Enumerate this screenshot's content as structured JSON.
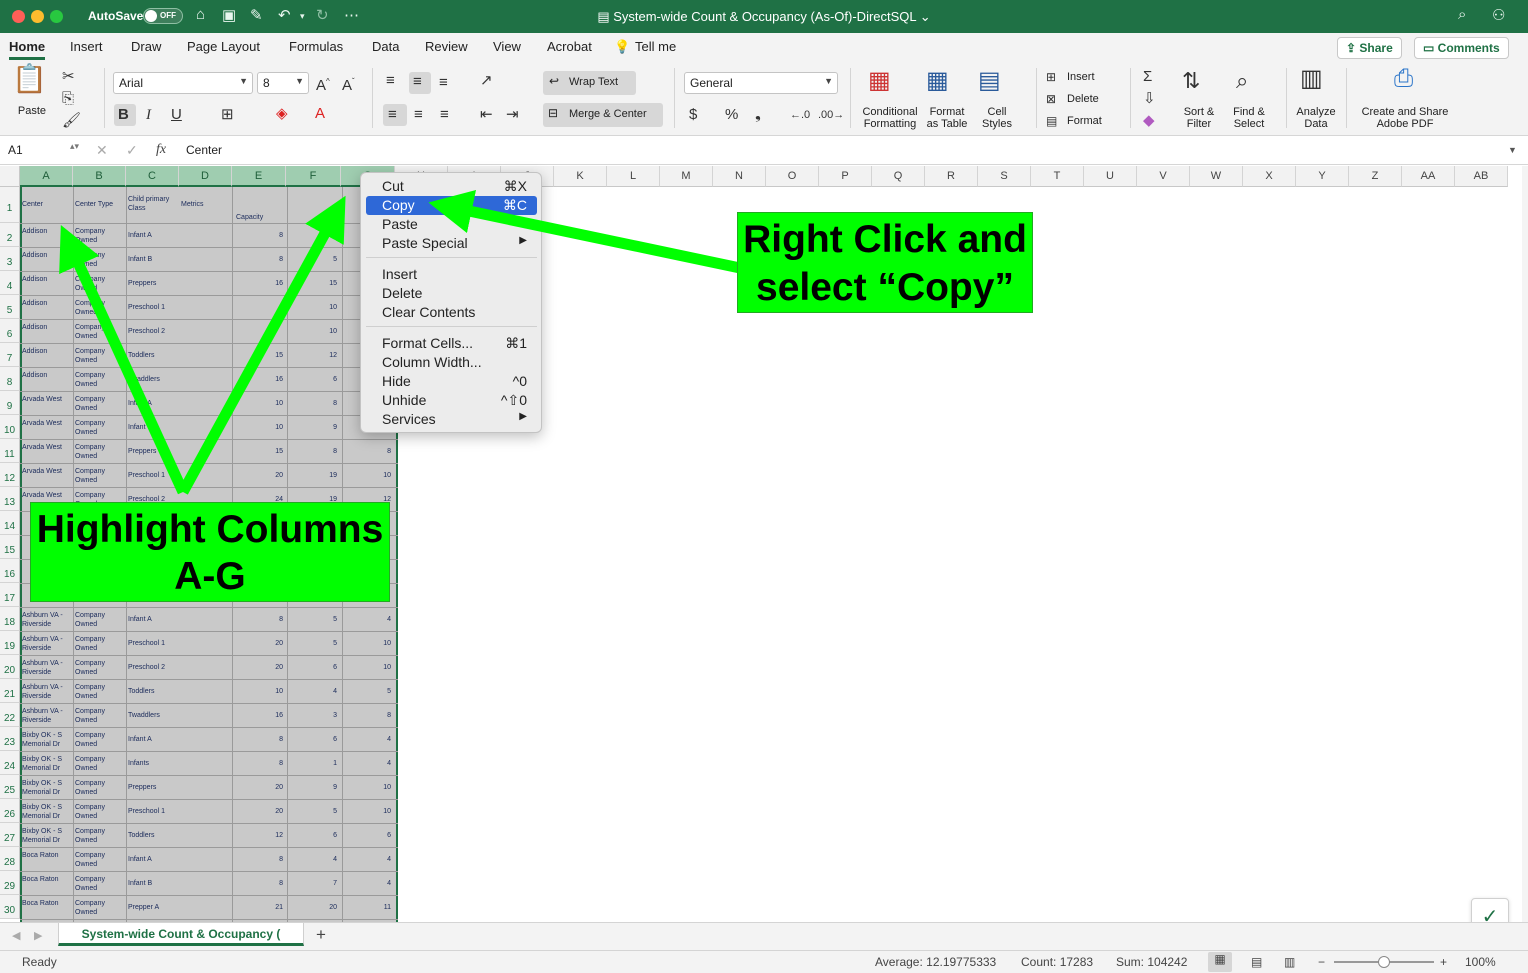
{
  "titlebar": {
    "autosave_label": "AutoSave",
    "autosave_state": "OFF",
    "doc_title": "System-wide Count & Occupancy (As-Of)-DirectSQL",
    "doc_title_caret": "⌄"
  },
  "menu": {
    "tabs": [
      "Home",
      "Insert",
      "Draw",
      "Page Layout",
      "Formulas",
      "Data",
      "Review",
      "View",
      "Acrobat",
      "Tell me"
    ],
    "share_label": "Share",
    "comments_label": "Comments"
  },
  "ribbon": {
    "paste_label": "Paste",
    "font_name": "Arial",
    "font_size": "8",
    "wrap_text_label": "Wrap Text",
    "merge_center_label": "Merge & Center",
    "number_format": "General",
    "conditional_formatting_label": "Conditional Formatting",
    "format_as_table_label": "Format as Table",
    "cell_styles_label": "Cell Styles",
    "insert_label": "Insert",
    "delete_label": "Delete",
    "format_label": "Format",
    "sort_filter_label": "Sort & Filter",
    "find_select_label": "Find & Select",
    "analyze_data_label": "Analyze Data",
    "adobe_pdf_label": "Create and Share Adobe PDF"
  },
  "formula_bar": {
    "cell_ref": "A1",
    "fx_label": "fx",
    "value": "Center"
  },
  "grid": {
    "columns": [
      "A",
      "B",
      "C",
      "D",
      "E",
      "F",
      "G",
      "H",
      "I",
      "J",
      "K",
      "L",
      "M",
      "N",
      "O",
      "P",
      "Q",
      "R",
      "S",
      "T",
      "U",
      "V",
      "W",
      "X",
      "Y",
      "Z",
      "AA",
      "AB"
    ],
    "header_row": {
      "A": "Center",
      "B": "Center Type",
      "C": "Child primary Class",
      "D": "Metrics",
      "E": "Capacity"
    },
    "rows": [
      {
        "n": "2",
        "A": "Addison",
        "B": "Company Owned",
        "C": "Infant A",
        "E": "8",
        "F": "",
        "G": ""
      },
      {
        "n": "3",
        "A": "Addison",
        "B": "Company Owned",
        "C": "Infant B",
        "E": "8",
        "F": "5",
        "G": ""
      },
      {
        "n": "4",
        "A": "Addison",
        "B": "Company Owned",
        "C": "Preppers",
        "E": "16",
        "F": "15",
        "G": ""
      },
      {
        "n": "5",
        "A": "Addison",
        "B": "Company Owned",
        "C": "Preschool 1",
        "E": "",
        "F": "10",
        "G": ""
      },
      {
        "n": "6",
        "A": "Addison",
        "B": "Company Owned",
        "C": "Preschool 2",
        "E": "",
        "F": "10",
        "G": ""
      },
      {
        "n": "7",
        "A": "Addison",
        "B": "Company Owned",
        "C": "Toddlers",
        "E": "15",
        "F": "12",
        "G": ""
      },
      {
        "n": "8",
        "A": "Addison",
        "B": "Company Owned",
        "C": "Twaddlers",
        "E": "16",
        "F": "6",
        "G": ""
      },
      {
        "n": "9",
        "A": "Arvada West",
        "B": "Company Owned",
        "C": "Infant A",
        "E": "10",
        "F": "8",
        "G": ""
      },
      {
        "n": "10",
        "A": "Arvada West",
        "B": "Company Owned",
        "C": "Infant B",
        "E": "10",
        "F": "9",
        "G": ""
      },
      {
        "n": "11",
        "A": "Arvada West",
        "B": "Company Owned",
        "C": "Preppers",
        "E": "15",
        "F": "8",
        "G": "8"
      },
      {
        "n": "12",
        "A": "Arvada West",
        "B": "Company Owned",
        "C": "Preschool 1",
        "E": "20",
        "F": "19",
        "G": "10"
      },
      {
        "n": "13",
        "A": "Arvada West",
        "B": "Company Owned",
        "C": "Preschool 2",
        "E": "24",
        "F": "19",
        "G": "12"
      },
      {
        "n": "14",
        "A": "",
        "B": "",
        "C": "",
        "E": "",
        "F": "",
        "G": ""
      },
      {
        "n": "15",
        "A": "",
        "B": "",
        "C": "",
        "E": "",
        "F": "",
        "G": ""
      },
      {
        "n": "16",
        "A": "",
        "B": "",
        "C": "",
        "E": "",
        "F": "",
        "G": ""
      },
      {
        "n": "17",
        "A": "",
        "B": "",
        "C": "",
        "E": "",
        "F": "",
        "G": ""
      },
      {
        "n": "18",
        "A": "Ashburn VA - Riverside",
        "B": "Company Owned",
        "C": "Infant A",
        "E": "8",
        "F": "5",
        "G": "4"
      },
      {
        "n": "19",
        "A": "Ashburn VA - Riverside",
        "B": "Company Owned",
        "C": "Preschool 1",
        "E": "20",
        "F": "5",
        "G": "10"
      },
      {
        "n": "20",
        "A": "Ashburn VA - Riverside",
        "B": "Company Owned",
        "C": "Preschool 2",
        "E": "20",
        "F": "6",
        "G": "10"
      },
      {
        "n": "21",
        "A": "Ashburn VA - Riverside",
        "B": "Company Owned",
        "C": "Toddlers",
        "E": "10",
        "F": "4",
        "G": "5"
      },
      {
        "n": "22",
        "A": "Ashburn VA - Riverside",
        "B": "Company Owned",
        "C": "Twaddlers",
        "E": "16",
        "F": "3",
        "G": "8"
      },
      {
        "n": "23",
        "A": "Bixby OK - S Memorial Dr",
        "B": "Company Owned",
        "C": "Infant A",
        "E": "8",
        "F": "6",
        "G": "4"
      },
      {
        "n": "24",
        "A": "Bixby OK - S Memorial Dr",
        "B": "Company Owned",
        "C": "Infants",
        "E": "8",
        "F": "1",
        "G": "4"
      },
      {
        "n": "25",
        "A": "Bixby OK - S Memorial Dr",
        "B": "Company Owned",
        "C": "Preppers",
        "E": "20",
        "F": "9",
        "G": "10"
      },
      {
        "n": "26",
        "A": "Bixby OK - S Memorial Dr",
        "B": "Company Owned",
        "C": "Preschool 1",
        "E": "20",
        "F": "5",
        "G": "10"
      },
      {
        "n": "27",
        "A": "Bixby OK - S Memorial Dr",
        "B": "Company Owned",
        "C": "Toddlers",
        "E": "12",
        "F": "6",
        "G": "6"
      },
      {
        "n": "28",
        "A": "Boca Raton",
        "B": "Company Owned",
        "C": "Infant A",
        "E": "8",
        "F": "4",
        "G": "4"
      },
      {
        "n": "29",
        "A": "Boca Raton",
        "B": "Company Owned",
        "C": "Infant B",
        "E": "8",
        "F": "7",
        "G": "4"
      },
      {
        "n": "30",
        "A": "Boca Raton",
        "B": "Company Owned",
        "C": "Prepper A",
        "E": "21",
        "F": "20",
        "G": "11"
      }
    ]
  },
  "context_menu": {
    "items": [
      {
        "label": "Cut",
        "shortcut": "⌘X"
      },
      {
        "label": "Copy",
        "shortcut": "⌘C"
      },
      {
        "label": "Paste",
        "shortcut": ""
      },
      {
        "label": "Paste Special",
        "shortcut": "▶"
      },
      {
        "label": "Insert",
        "shortcut": ""
      },
      {
        "label": "Delete",
        "shortcut": ""
      },
      {
        "label": "Clear Contents",
        "shortcut": ""
      },
      {
        "label": "Format Cells...",
        "shortcut": "⌘1"
      },
      {
        "label": "Column Width...",
        "shortcut": ""
      },
      {
        "label": "Hide",
        "shortcut": "^0"
      },
      {
        "label": "Unhide",
        "shortcut": "^⇧0"
      },
      {
        "label": "Services",
        "shortcut": "▶"
      }
    ],
    "highlighted": "Copy"
  },
  "annotations": {
    "callout_right_line1": "Right Click and",
    "callout_right_line2": "select “Copy”",
    "callout_left_line1": "Highlight Columns",
    "callout_left_line2": "A-G",
    "callout_color": "#00ff00"
  },
  "sheet_tabs": {
    "active_tab": "System-wide Count & Occupancy (",
    "add_label": "+"
  },
  "status": {
    "mode": "Ready",
    "average": "Average: 12.19775333",
    "count": "Count: 17283",
    "sum": "Sum: 104242",
    "zoom": "100%",
    "zoom_level": 1.0
  },
  "colors": {
    "accent": "#1f7145",
    "selection_highlight": "#2e68d7"
  }
}
